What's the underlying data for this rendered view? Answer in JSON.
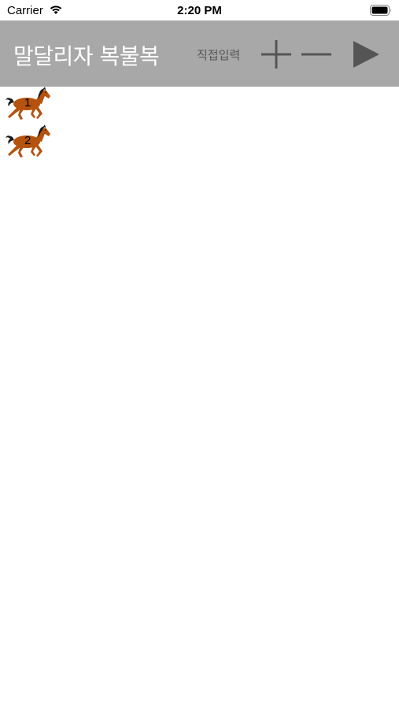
{
  "status_bar": {
    "carrier": "Carrier",
    "time": "2:20 PM"
  },
  "toolbar": {
    "title": "말달리자 복불복",
    "direct_input_label": "직접입력",
    "background_color": "#a8a8a8",
    "icons": {
      "add": "plus-icon",
      "remove": "minus-icon",
      "start": "play-icon"
    }
  },
  "horses": [
    {
      "number": "1"
    },
    {
      "number": "2"
    }
  ],
  "colors": {
    "horse_body": "#b5520d",
    "horse_mane": "#1a1a1a",
    "icon_gray": "#555555"
  }
}
